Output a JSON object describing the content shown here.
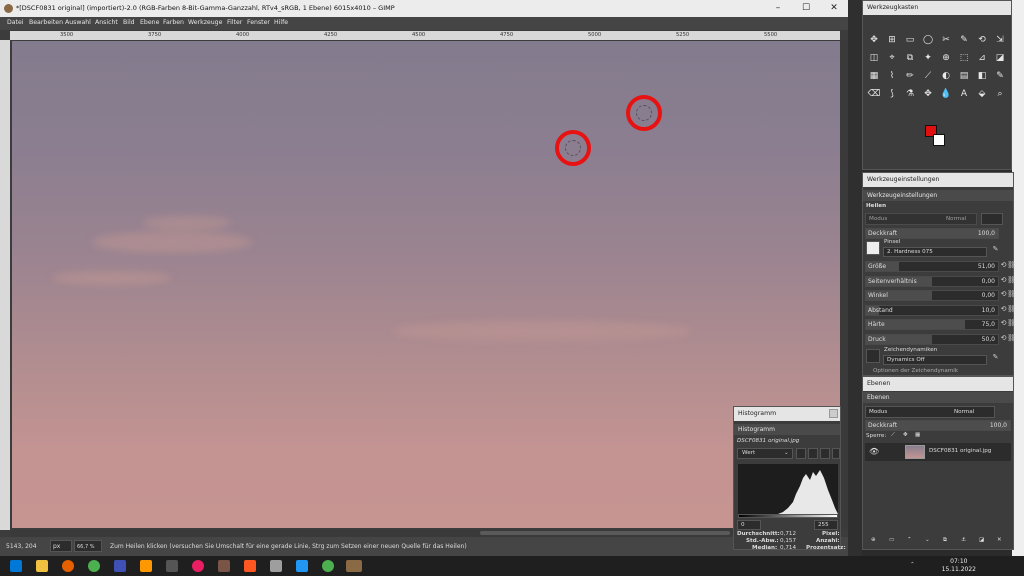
{
  "window": {
    "title": "*[DSCF0831 original] (importiert)-2.0 (RGB-Farben 8-Bit-Gamma-Ganzzahl, RTv4_sRGB, 1 Ebene) 6015x4010 – GIMP",
    "minimize": "–",
    "maximize": "☐",
    "close": "✕"
  },
  "menu": [
    "Datei",
    "Bearbeiten",
    "Auswahl",
    "Ansicht",
    "Bild",
    "Ebene",
    "Farben",
    "Werkzeuge",
    "Filter",
    "Fenster",
    "Hilfe"
  ],
  "ruler": {
    "ticks": [
      "3500",
      "3750",
      "4000",
      "4250",
      "4500",
      "4750",
      "5000",
      "5250",
      "5500"
    ]
  },
  "status": {
    "coords": "5143, 204",
    "unit": "px",
    "zoom": "66,7 %",
    "message": "Zum Heilen klicken (versuchen Sie Umschalt für eine gerade Linie, Strg zum Setzen einer neuen Quelle für das Heilen)"
  },
  "histogram": {
    "dock_title": "Histogramm",
    "tab_label": "Histogramm",
    "image_name": "DSCF0831 original.jpg",
    "channel": "Wert",
    "range_min": "0",
    "range_max": "255",
    "stats": [
      {
        "label": "Durchschnitt:",
        "value": "0,712",
        "label2": "Pixel:"
      },
      {
        "label": "Std.-Abw.:",
        "value": "0,157",
        "label2": "Anzahl:"
      },
      {
        "label": "Median:",
        "value": "0,714",
        "label2": "Prozentsatz:"
      }
    ]
  },
  "toolbox": {
    "title": "Werkzeugkasten",
    "tools": [
      "✥",
      "⊞",
      "▭",
      "◯",
      "✂",
      "✎",
      "⟲",
      "⇲",
      "◫",
      "⌖",
      "⧉",
      "✦",
      "⊕",
      "⬚",
      "⊿",
      "◪",
      "▦",
      "⌇",
      "✏",
      "⟋",
      "◐",
      "▤",
      "◧",
      "✎",
      "⌫",
      "⟆",
      "⚗",
      "✥",
      "💧",
      "A",
      "⬙",
      "⌕"
    ],
    "fg_color": "#e01010",
    "bg_color": "#ffffff"
  },
  "tool_options": {
    "dock_title": "Werkzeugeinstellungen",
    "tab_label": "Werkzeugeinstellungen",
    "tool_name": "Heilen",
    "mode_label": "Modus",
    "mode_value": "Normal",
    "opacity_label": "Deckkraft",
    "opacity_value": "100,0",
    "brush_label": "Pinsel",
    "brush_value": "2. Hardness 075",
    "rows": [
      {
        "label": "Größe",
        "value": "51,00",
        "fill": 0.25
      },
      {
        "label": "Seitenverhältnis",
        "value": "0,00",
        "fill": 0.5
      },
      {
        "label": "Winkel",
        "value": "0,00",
        "fill": 0.5
      },
      {
        "label": "Abstand",
        "value": "10,0",
        "fill": 0.1
      },
      {
        "label": "Härte",
        "value": "75,0",
        "fill": 0.75
      },
      {
        "label": "Druck",
        "value": "50,0",
        "fill": 0.5
      }
    ],
    "dynamics_label": "Zeichendynamiken",
    "dynamics_value": "Dynamics Off",
    "dynamics_options": "Optionen der Zeichendynamik"
  },
  "layers": {
    "dock_title": "Ebenen",
    "tab_label": "Ebenen",
    "mode_label": "Modus",
    "mode_value": "Normal",
    "opacity_label": "Deckkraft",
    "opacity_value": "100,0",
    "lock_label": "Sperre:",
    "layer_name": "DSCF0831 original.jpg"
  },
  "taskbar": {
    "time": "07:10",
    "date": "15.11.2022"
  }
}
